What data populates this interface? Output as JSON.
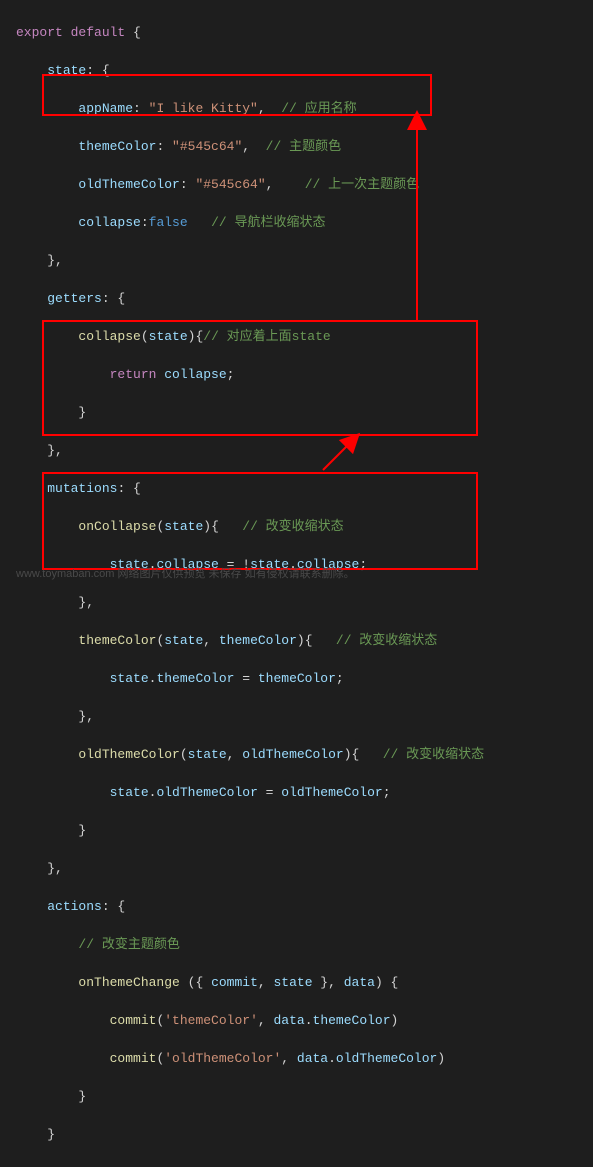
{
  "code": {
    "l1": {
      "kw1": "export",
      "kw2": "default",
      "brace": " {"
    },
    "l2": {
      "prop": "state",
      "rest": ": {"
    },
    "l3": {
      "prop": "appName",
      "colon": ": ",
      "str": "\"I like Kitty\"",
      "comma": ",  ",
      "cmt": "// 应用名称"
    },
    "l4": {
      "prop": "themeColor",
      "colon": ": ",
      "str": "\"#545c64\"",
      "comma": ",  ",
      "cmt": "// 主题颜色"
    },
    "l5": {
      "prop": "oldThemeColor",
      "colon": ": ",
      "str": "\"#545c64\"",
      "comma": ",    ",
      "cmt": "// 上一次主题颜色"
    },
    "l6": {
      "prop": "collapse",
      "colon": ":",
      "bool": "false",
      "sp": "   ",
      "cmt": "// 导航栏收缩状态"
    },
    "l7": {
      "close": "},"
    },
    "l8": {
      "prop": "getters",
      "rest": ": {"
    },
    "l9": {
      "func": "collapse",
      "paren": "(",
      "param": "state",
      "rest": "){",
      "cmt": "// 对应着上面state"
    },
    "l10": {
      "kw": "return",
      "sp": " ",
      "var": "collapse",
      "semi": ";"
    },
    "l11": {
      "close": "}"
    },
    "l12": {
      "close": "},"
    },
    "l13": {
      "prop": "mutations",
      "rest": ": {"
    },
    "l14": {
      "func": "onCollapse",
      "paren": "(",
      "param": "state",
      "rest": "){   ",
      "cmt": "// 改变收缩状态"
    },
    "l15": {
      "obj": "state",
      "dot": ".",
      "p1": "collapse",
      "eq": " = !",
      "obj2": "state",
      "dot2": ".",
      "p2": "collapse",
      "semi": ";"
    },
    "l16": {
      "close": "},"
    },
    "l17": {
      "func": "themeColor",
      "paren": "(",
      "param1": "state",
      "comma": ", ",
      "param2": "themeColor",
      "rest": "){   ",
      "cmt": "// 改变收缩状态"
    },
    "l18": {
      "obj": "state",
      "dot": ".",
      "p1": "themeColor",
      "eq": " = ",
      "var": "themeColor",
      "semi": ";"
    },
    "l19": {
      "close": "},"
    },
    "l20": {
      "func": "oldThemeColor",
      "paren": "(",
      "param1": "state",
      "comma": ", ",
      "param2": "oldThemeColor",
      "rest": "){   ",
      "cmt": "// 改变收缩状态"
    },
    "l21": {
      "obj": "state",
      "dot": ".",
      "p1": "oldThemeColor",
      "eq": " = ",
      "var": "oldThemeColor",
      "semi": ";"
    },
    "l22": {
      "close": "}"
    },
    "l23": {
      "close": "},"
    },
    "l24": {
      "prop": "actions",
      "rest": ": {"
    },
    "l25": {
      "cmt": "// 改变主题颜色"
    },
    "l26": {
      "func": "onThemeChange",
      "sp": " ({ ",
      "param1": "commit",
      "comma": ", ",
      "param2": "state",
      "rest": " }, ",
      "param3": "data",
      "close": ") {"
    },
    "l27": {
      "func": "commit",
      "paren": "(",
      "str": "'themeColor'",
      "comma": ", ",
      "obj": "data",
      "dot": ".",
      "p1": "themeColor",
      "close": ")"
    },
    "l28": {
      "func": "commit",
      "paren": "(",
      "str": "'oldThemeColor'",
      "comma": ", ",
      "obj": "data",
      "dot": ".",
      "p1": "oldThemeColor",
      "close": ")"
    },
    "l29": {
      "close": "}"
    },
    "l30": {
      "close": "}"
    }
  },
  "watermark": "www.toymaban.com 网络图片仅供预览 未保存 如有侵权请联系删除。"
}
